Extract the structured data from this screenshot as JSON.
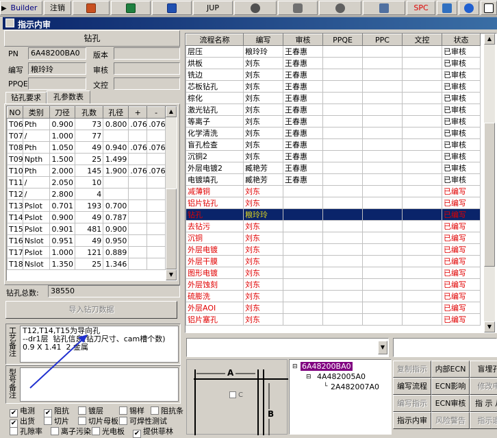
{
  "toolbar": {
    "items": [
      "Builder",
      "注销",
      "",
      "",
      "",
      "JUP",
      "",
      "",
      "",
      "",
      "SPC",
      "",
      "",
      ""
    ]
  },
  "window": {
    "title": "指示内审"
  },
  "drill_panel": {
    "heading": "钻孔",
    "pn_label": "PN",
    "pn_value": "6A48200BA0",
    "version_label": "版本",
    "version_value": "",
    "author_label": "编写",
    "author_value": "粮玲玲",
    "review_label": "审核",
    "review_value": "",
    "ppqe_label": "PPQE",
    "ppqe_value": "",
    "wenkong_label": "文控",
    "wenkong_value": "",
    "tabs": [
      "钻孔要求",
      "孔参数表"
    ],
    "columns": [
      "NO",
      "类别",
      "刀径",
      "孔数",
      "孔径",
      "+",
      "-"
    ],
    "rows": [
      [
        "T06",
        "Pth",
        "0.900",
        "73",
        "0.800",
        ".076",
        ".076"
      ],
      [
        "T07",
        "/",
        "1.000",
        "77",
        "",
        "",
        ""
      ],
      [
        "T08",
        "Pth",
        "1.050",
        "49",
        "0.940",
        ".076",
        ".076"
      ],
      [
        "T09",
        "Npth",
        "1.500",
        "25",
        "1.499",
        "",
        ""
      ],
      [
        "T10",
        "Pth",
        "2.000",
        "145",
        "1.900",
        ".076",
        ".076"
      ],
      [
        "T11",
        "/",
        "2.050",
        "10",
        "",
        "",
        ""
      ],
      [
        "T12",
        "/",
        "2.800",
        "4",
        "",
        "",
        ""
      ],
      [
        "T13",
        "Pslot",
        "0.701",
        "193",
        "0.700",
        "",
        ""
      ],
      [
        "T14",
        "Pslot",
        "0.900",
        "49",
        "0.787",
        "",
        ""
      ],
      [
        "T15",
        "Pslot",
        "0.901",
        "481",
        "0.900",
        "",
        ""
      ],
      [
        "T16",
        "Nslot",
        "0.951",
        "49",
        "0.950",
        "",
        ""
      ],
      [
        "T17",
        "Pslot",
        "1.000",
        "121",
        "0.889",
        "",
        ""
      ],
      [
        "T18",
        "Nslot",
        "1.350",
        "25",
        "1.346",
        "",
        ""
      ]
    ],
    "total_label": "钻孔总数:",
    "total_value": "38550",
    "import_button": "导入钻刀数据",
    "remark_label": "工艺备注",
    "remark_text": "T12,T14,T15为导向孔\n--dr1层  钻孔信息(钻刀尺寸、cam槽个数)\n0.9 X 1.41  2 金属",
    "model_remark_label": "型号备注",
    "model_remark_text": "",
    "checkboxes": [
      {
        "label": "电测",
        "checked": true
      },
      {
        "label": "阻抗",
        "checked": true
      },
      {
        "label": "镀层",
        "checked": false
      },
      {
        "label": "锡样",
        "checked": false
      },
      {
        "label": "阻抗条",
        "checked": false
      },
      {
        "label": "出货",
        "checked": true
      },
      {
        "label": "切片",
        "checked": false
      },
      {
        "label": "切片母板",
        "checked": false
      },
      {
        "label": "可焊性测试",
        "checked": false
      },
      {
        "label": "孔隙率",
        "checked": false
      },
      {
        "label": "离子污染",
        "checked": false
      },
      {
        "label": "光电板",
        "checked": false
      },
      {
        "label": "提供菲林",
        "checked": true
      }
    ]
  },
  "process_table": {
    "columns": [
      "流程名称",
      "编写",
      "审核",
      "PPQE",
      "PPC",
      "文控",
      "状态"
    ],
    "rows": [
      {
        "cells": [
          "层压",
          "粮玲玲",
          "王春惠",
          "",
          "",
          "",
          "已审核"
        ],
        "style": "normal"
      },
      {
        "cells": [
          "烘板",
          "刘东",
          "王春惠",
          "",
          "",
          "",
          "已审核"
        ],
        "style": "normal"
      },
      {
        "cells": [
          "铣边",
          "刘东",
          "王春惠",
          "",
          "",
          "",
          "已审核"
        ],
        "style": "normal"
      },
      {
        "cells": [
          "芯板钻孔",
          "刘东",
          "王春惠",
          "",
          "",
          "",
          "已审核"
        ],
        "style": "normal"
      },
      {
        "cells": [
          "棕化",
          "刘东",
          "王春惠",
          "",
          "",
          "",
          "已审核"
        ],
        "style": "normal"
      },
      {
        "cells": [
          "激光钻孔",
          "刘东",
          "王春惠",
          "",
          "",
          "",
          "已审核"
        ],
        "style": "normal"
      },
      {
        "cells": [
          "等离子",
          "刘东",
          "王春惠",
          "",
          "",
          "",
          "已审核"
        ],
        "style": "normal"
      },
      {
        "cells": [
          "化学清洗",
          "刘东",
          "王春惠",
          "",
          "",
          "",
          "已审核"
        ],
        "style": "normal"
      },
      {
        "cells": [
          "盲孔检查",
          "刘东",
          "王春惠",
          "",
          "",
          "",
          "已审核"
        ],
        "style": "normal"
      },
      {
        "cells": [
          "沉铜2",
          "刘东",
          "王春惠",
          "",
          "",
          "",
          "已审核"
        ],
        "style": "normal"
      },
      {
        "cells": [
          "外层电镀2",
          "臧艳芳",
          "王春惠",
          "",
          "",
          "",
          "已审核"
        ],
        "style": "normal"
      },
      {
        "cells": [
          "电镀填孔",
          "臧艳芳",
          "王春惠",
          "",
          "",
          "",
          "已审核"
        ],
        "style": "normal"
      },
      {
        "cells": [
          "减薄铜",
          "刘东",
          "",
          "",
          "",
          "",
          "已编写"
        ],
        "style": "red"
      },
      {
        "cells": [
          "铝片钻孔",
          "刘东",
          "",
          "",
          "",
          "",
          "已编写"
        ],
        "style": "red"
      },
      {
        "cells": [
          "钻孔",
          "粮玲玲",
          "",
          "",
          "",
          "",
          "已编写"
        ],
        "style": "selected"
      },
      {
        "cells": [
          "去钻污",
          "刘东",
          "",
          "",
          "",
          "",
          "已编写"
        ],
        "style": "red"
      },
      {
        "cells": [
          "沉铜",
          "刘东",
          "",
          "",
          "",
          "",
          "已编写"
        ],
        "style": "red"
      },
      {
        "cells": [
          "外层电镀",
          "刘东",
          "",
          "",
          "",
          "",
          "已编写"
        ],
        "style": "red"
      },
      {
        "cells": [
          "外层干膜",
          "刘东",
          "",
          "",
          "",
          "",
          "已编写"
        ],
        "style": "red"
      },
      {
        "cells": [
          "图形电镀",
          "刘东",
          "",
          "",
          "",
          "",
          "已编写"
        ],
        "style": "red"
      },
      {
        "cells": [
          "外层蚀刻",
          "刘东",
          "",
          "",
          "",
          "",
          "已编写"
        ],
        "style": "red"
      },
      {
        "cells": [
          "硫膨洗",
          "刘东",
          "",
          "",
          "",
          "",
          "已编写"
        ],
        "style": "red"
      },
      {
        "cells": [
          "外层AOI",
          "刘东",
          "",
          "",
          "",
          "",
          "已编写"
        ],
        "style": "red"
      },
      {
        "cells": [
          "铝片塞孔",
          "刘东",
          "",
          "",
          "",
          "",
          "已编写"
        ],
        "style": "red"
      }
    ]
  },
  "tree": {
    "root": "6A48200BA0",
    "child": "4A482005A0",
    "grandchild": "2A482007A0"
  },
  "diagram": {
    "label_a": "A",
    "label_b": "B",
    "label_c": "C"
  },
  "buttons": [
    {
      "label": "复制指示",
      "enabled": false
    },
    {
      "label": "内部ECN",
      "enabled": true
    },
    {
      "label": "盲埋孔",
      "enabled": true
    },
    {
      "label": "编写流程",
      "enabled": true
    },
    {
      "label": "ECN影响",
      "enabled": true
    },
    {
      "label": "修改申",
      "enabled": false
    },
    {
      "label": "编写指示",
      "enabled": false
    },
    {
      "label": "ECN审核",
      "enabled": true
    },
    {
      "label": "指 示 从",
      "enabled": true
    },
    {
      "label": "指示内审",
      "enabled": true
    },
    {
      "label": "风险警告",
      "enabled": false
    },
    {
      "label": "指示退",
      "enabled": false
    }
  ]
}
